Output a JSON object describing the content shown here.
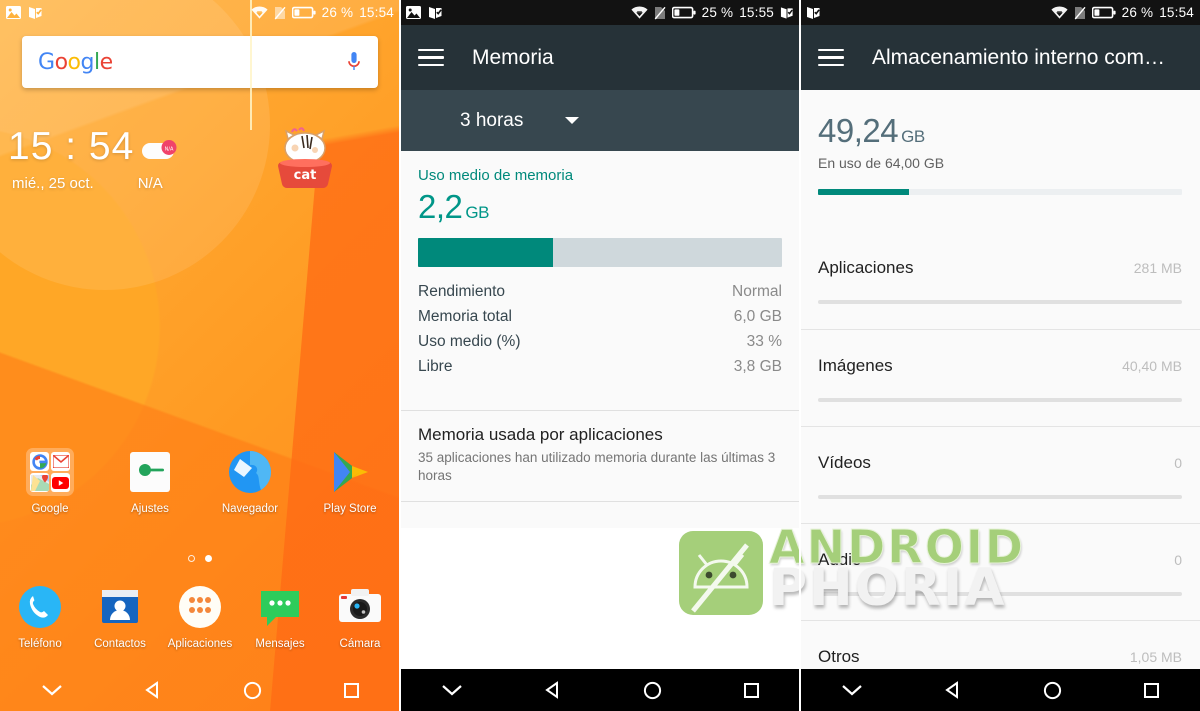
{
  "panels": {
    "home": {
      "status": {
        "battery_pct": "26 %",
        "clock": "15:54"
      },
      "search": {
        "logo_letters": [
          "G",
          "o",
          "o",
          "g",
          "l",
          "e"
        ],
        "mic_label": "voice-search"
      },
      "clock_widget": {
        "time": "15 : 54",
        "date": "mié., 25 oct.",
        "weather": "N/A"
      },
      "apps_row1": [
        {
          "label": "Google"
        },
        {
          "label": "Ajustes"
        },
        {
          "label": "Navegador"
        },
        {
          "label": "Play Store"
        }
      ],
      "dock": [
        {
          "label": "Teléfono"
        },
        {
          "label": "Contactos"
        },
        {
          "label": "Aplicaciones"
        },
        {
          "label": "Mensajes"
        },
        {
          "label": "Cámara"
        }
      ],
      "page_dots": 2,
      "page_active_index": 1
    },
    "memoria": {
      "status": {
        "battery_pct": "25 %",
        "clock": "15:55"
      },
      "title": "Memoria",
      "spinner_value": "3 horas",
      "section_header": "Uso medio de memoria",
      "avg_value": "2,2",
      "avg_unit": "GB",
      "usage_percent_fill": 37,
      "stats": [
        {
          "key": "Rendimiento",
          "value": "Normal"
        },
        {
          "key": "Memoria total",
          "value": "6,0 GB"
        },
        {
          "key": "Uso medio (%)",
          "value": "33 %"
        },
        {
          "key": "Libre",
          "value": "3,8 GB"
        }
      ],
      "apps_section": {
        "title": "Memoria usada por aplicaciones",
        "subtitle": "35 aplicaciones han utilizado memoria durante las últimas 3 horas"
      }
    },
    "almacenamiento": {
      "status": {
        "battery_pct": "26 %",
        "clock": "15:54"
      },
      "title": "Almacenamiento interno com…",
      "used_value": "49,24",
      "used_unit": "GB",
      "used_subtitle": "En uso de 64,00 GB",
      "used_percent_fill": 25,
      "rows": [
        {
          "name": "Aplicaciones",
          "size": "281 MB",
          "fill": 100
        },
        {
          "name": "Imágenes",
          "size": "40,40 MB",
          "fill": 100
        },
        {
          "name": "Vídeos",
          "size": "0",
          "fill": 100
        },
        {
          "name": "Audio",
          "size": "0",
          "fill": 100
        },
        {
          "name": "Otros",
          "size": "1,05 MB",
          "fill": 0
        }
      ]
    }
  },
  "watermark": {
    "line1": "ANDROID",
    "line2": "PHORIA"
  },
  "colors": {
    "teal": "#00897B",
    "toolbar": "#263238",
    "spinner_bar": "#37474F",
    "orange": "#FF9A22",
    "status_dark": "#121212"
  }
}
